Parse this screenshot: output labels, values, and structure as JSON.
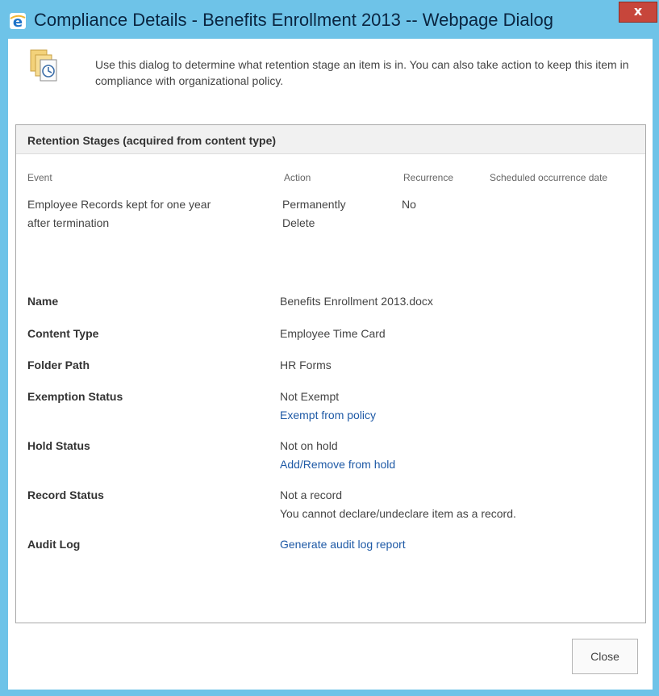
{
  "window": {
    "title": "Compliance Details - Benefits Enrollment 2013 -- Webpage Dialog",
    "close_glyph": "x"
  },
  "intro": {
    "text": "Use this dialog to determine what retention stage an item is in. You can also take action to keep this item in compliance with organizational policy."
  },
  "retention": {
    "title": "Retention Stages (acquired from content type)",
    "columns": [
      "Event",
      "Action",
      "Recurrence",
      "Scheduled occurrence date"
    ],
    "rows": [
      {
        "event_line1": "Employee Records kept for one year",
        "event_line2": "after termination",
        "action_line1": "Permanently",
        "action_line2": "Delete",
        "recurrence": "No",
        "scheduled": ""
      }
    ]
  },
  "details": {
    "name": {
      "label": "Name",
      "value": "Benefits Enrollment 2013.docx"
    },
    "content_type": {
      "label": "Content Type",
      "value": "Employee Time Card"
    },
    "folder_path": {
      "label": "Folder Path",
      "value": "HR Forms"
    },
    "exemption": {
      "label": "Exemption Status",
      "value": "Not Exempt",
      "link": "Exempt from policy"
    },
    "hold": {
      "label": "Hold Status",
      "value": "Not on hold",
      "link": "Add/Remove from hold"
    },
    "record": {
      "label": "Record Status",
      "value": "Not a record",
      "note": "You cannot declare/undeclare item as a record."
    },
    "audit": {
      "label": "Audit Log",
      "link": "Generate audit log report"
    }
  },
  "footer": {
    "close_label": "Close"
  },
  "colors": {
    "frame": "#6ec3e8",
    "link": "#1f5aa6",
    "close_red": "#c7463b"
  },
  "icons": {
    "title_icon": "internet-explorer-icon",
    "intro_icon": "documents-clock-icon"
  }
}
